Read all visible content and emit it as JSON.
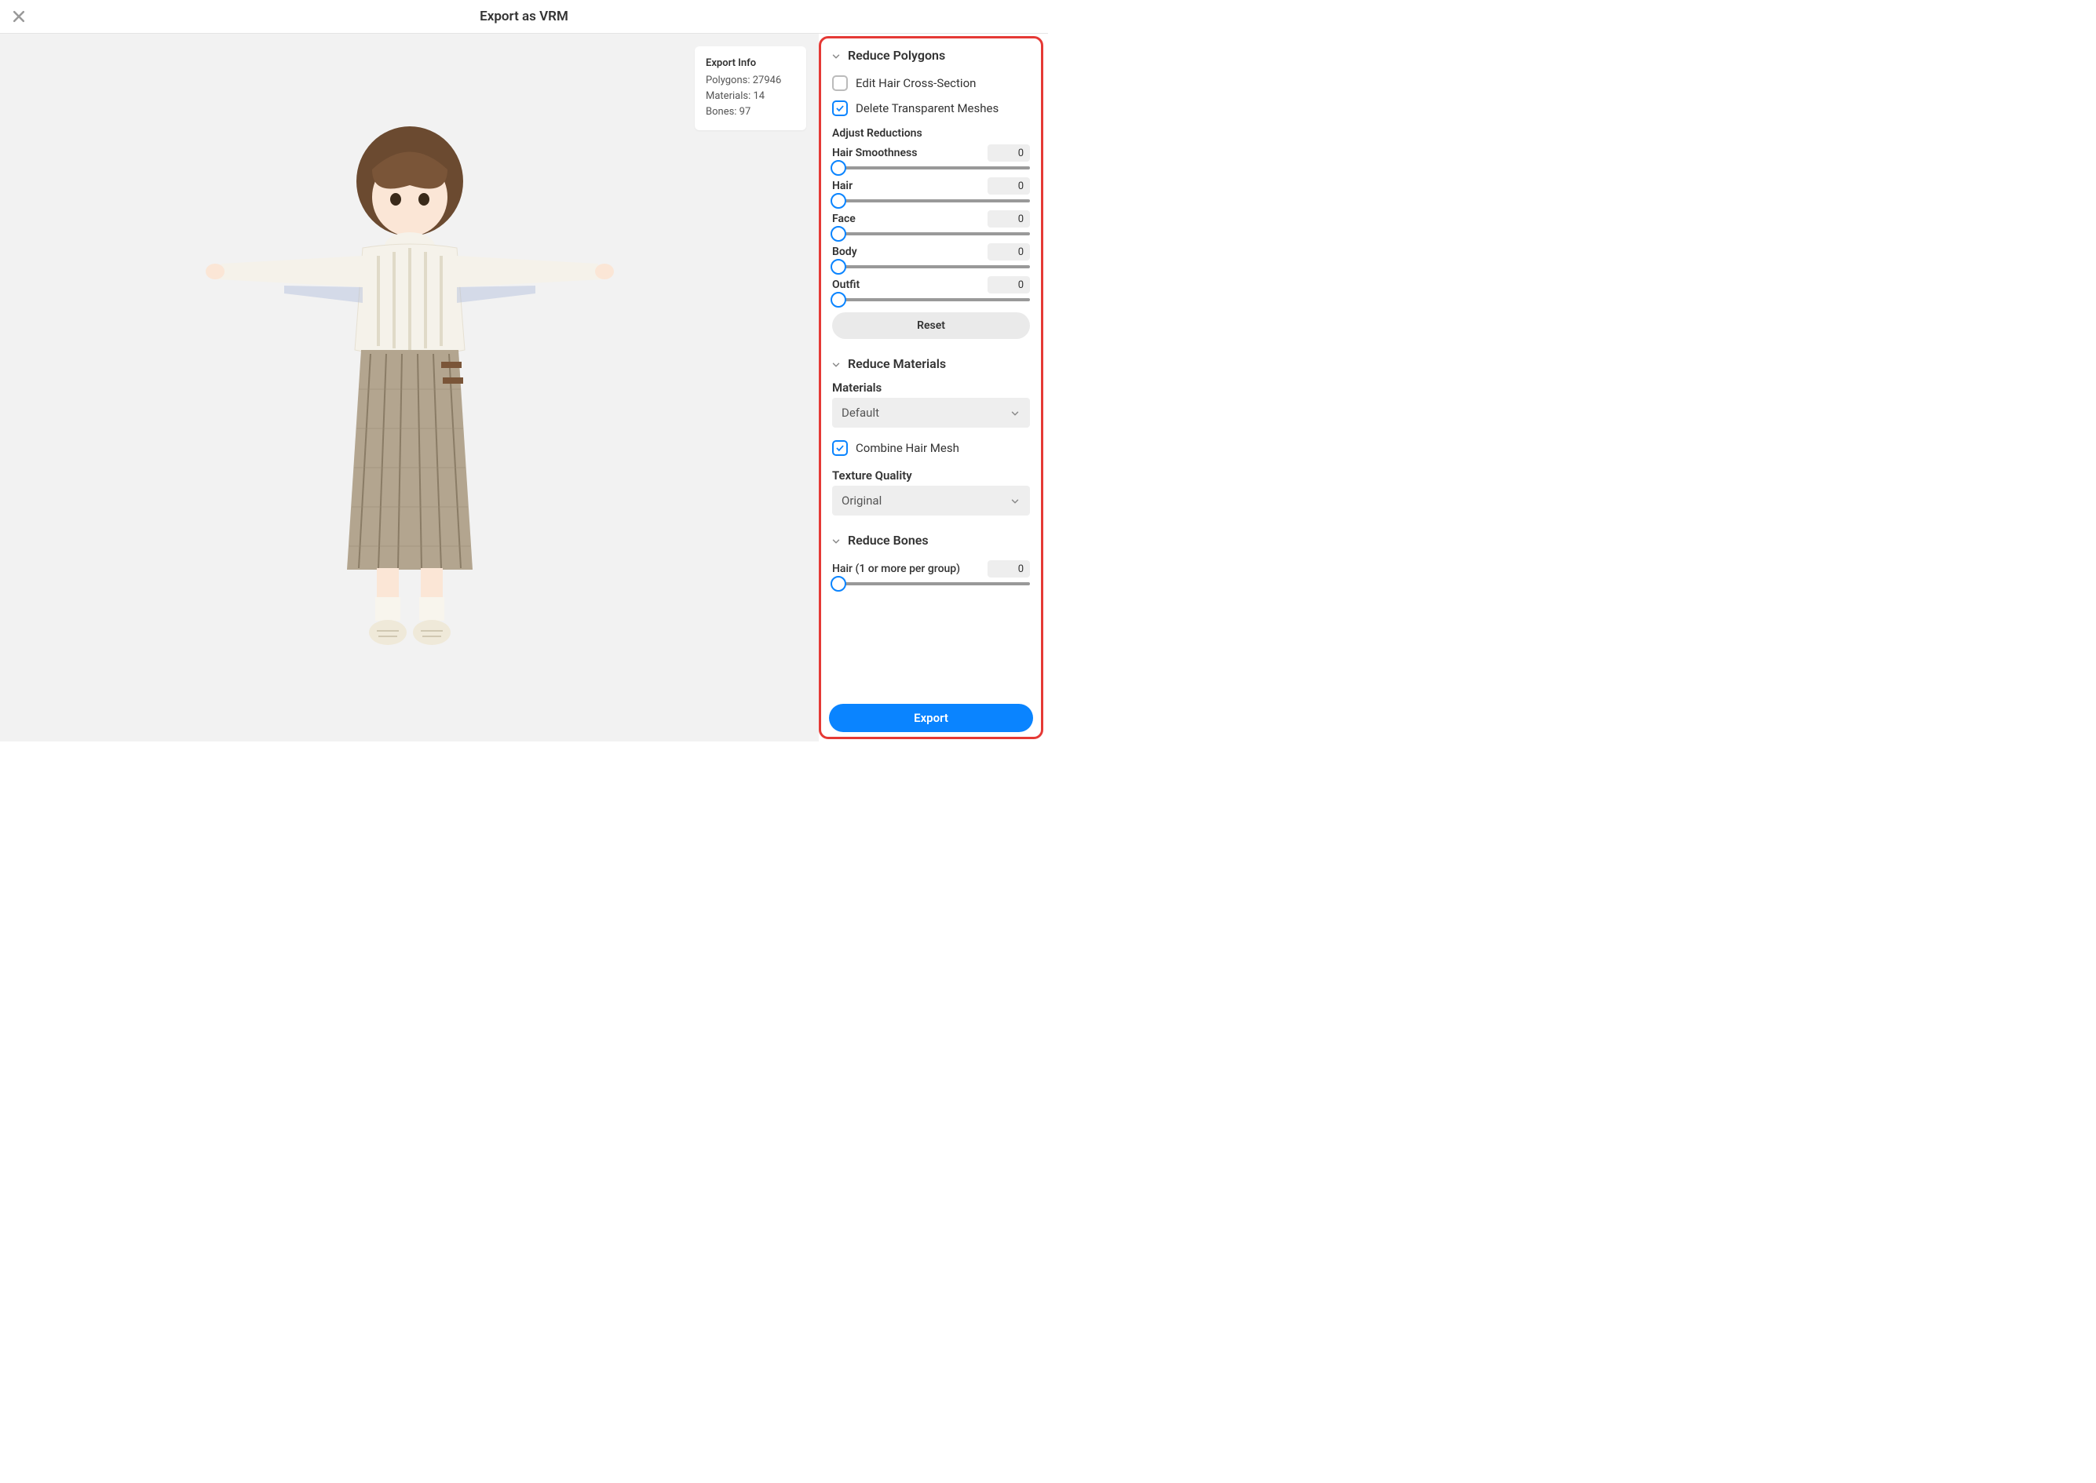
{
  "header": {
    "title": "Export as VRM"
  },
  "exportInfo": {
    "title": "Export Info",
    "polygonsLabel": "Polygons",
    "polygonsValue": "27946",
    "materialsLabel": "Materials",
    "materialsValue": "14",
    "bonesLabel": "Bones",
    "bonesValue": "97"
  },
  "section1": {
    "title": "Reduce Polygons",
    "editHairCrossSection": {
      "label": "Edit Hair Cross-Section",
      "checked": false
    },
    "deleteTransparentMeshes": {
      "label": "Delete Transparent Meshes",
      "checked": true
    },
    "adjustReductionsTitle": "Adjust Reductions",
    "sliders": [
      {
        "label": "Hair Smoothness",
        "value": "0"
      },
      {
        "label": "Hair",
        "value": "0"
      },
      {
        "label": "Face",
        "value": "0"
      },
      {
        "label": "Body",
        "value": "0"
      },
      {
        "label": "Outfit",
        "value": "0"
      }
    ],
    "resetLabel": "Reset"
  },
  "section2": {
    "title": "Reduce Materials",
    "materialsLabel": "Materials",
    "materialsDropdown": "Default",
    "combineHairMesh": {
      "label": "Combine Hair Mesh",
      "checked": true
    },
    "textureQualityLabel": "Texture Quality",
    "textureQualityDropdown": "Original"
  },
  "section3": {
    "title": "Reduce Bones",
    "slider": {
      "label": "Hair (1 or more per group)",
      "value": "0"
    }
  },
  "exportButtonLabel": "Export"
}
